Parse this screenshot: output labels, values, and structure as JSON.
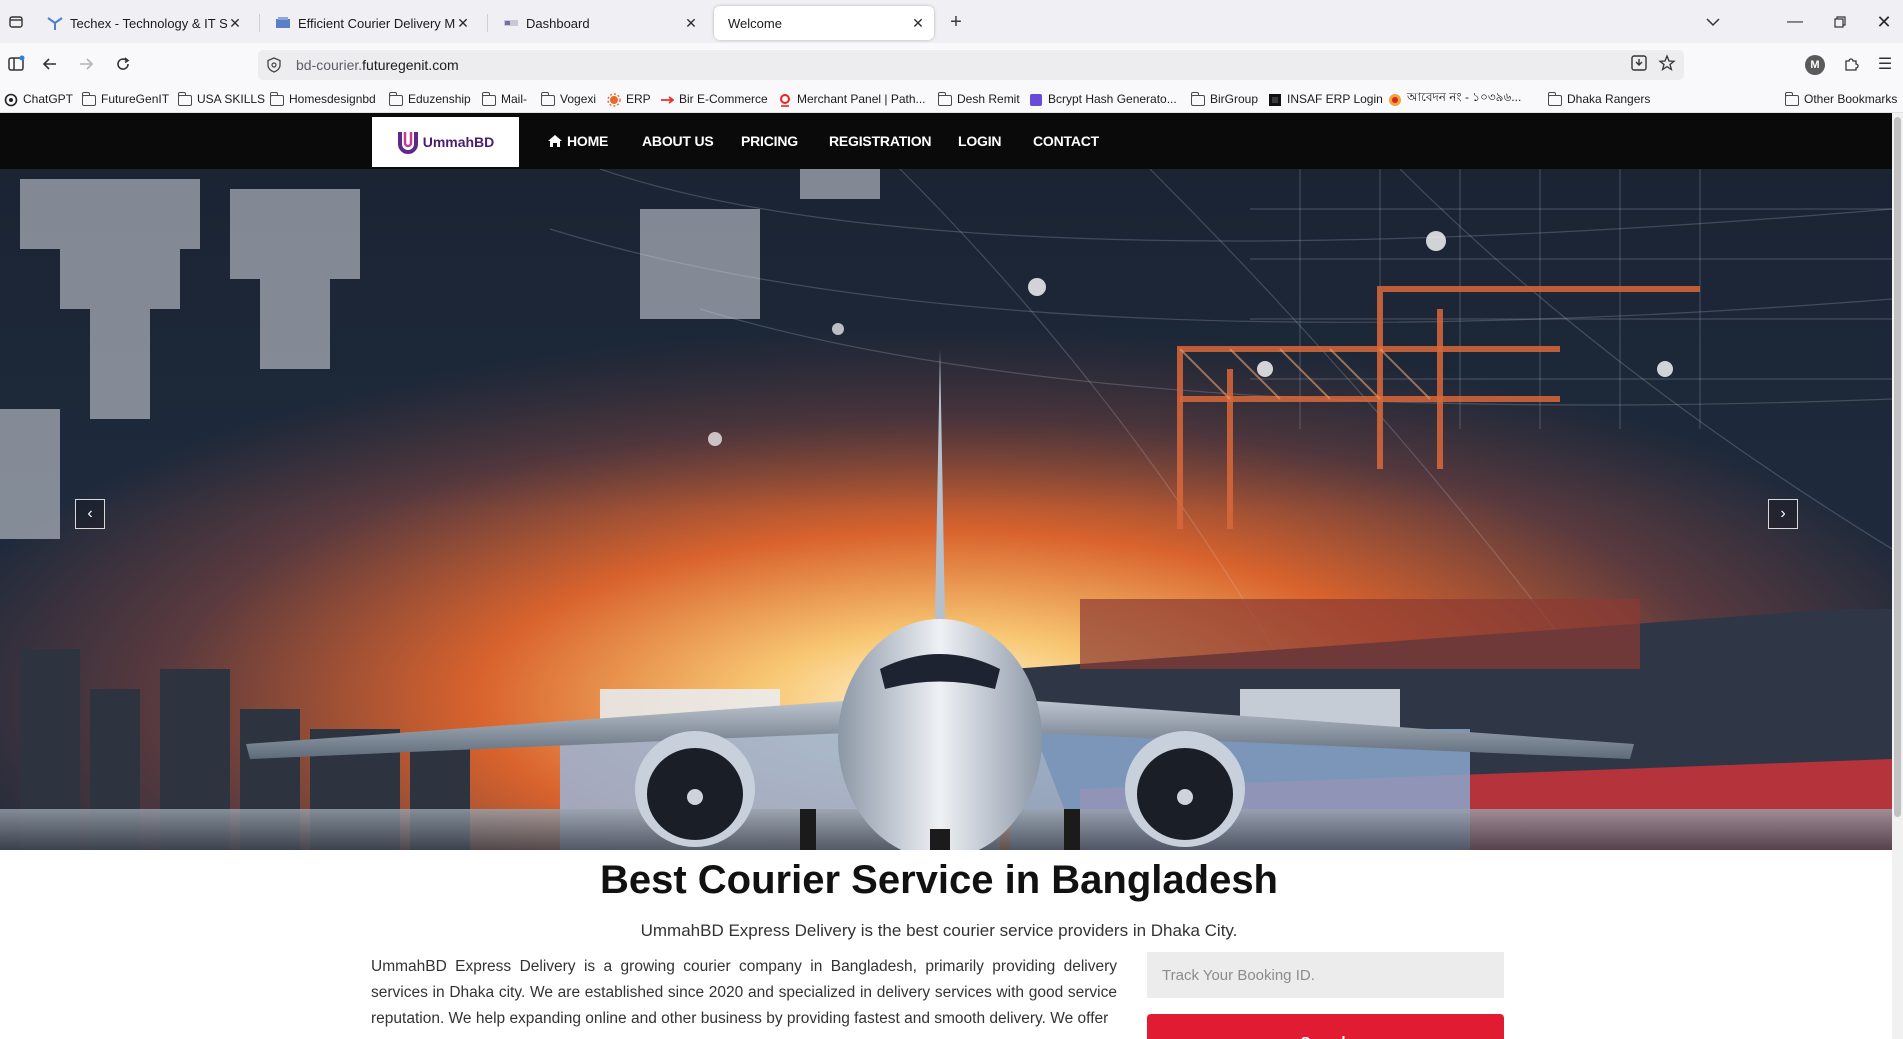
{
  "browser": {
    "tabs": [
      {
        "title": "Techex - Technology & IT Servic",
        "active": false
      },
      {
        "title": "Efficient Courier Delivery Manag",
        "active": false
      },
      {
        "title": "Dashboard",
        "active": false
      },
      {
        "title": "Welcome",
        "active": true
      }
    ],
    "url": {
      "prefix": "bd-courier.",
      "host": "futuregenit.com"
    },
    "profile_initial": "M",
    "bookmarks": [
      {
        "label": "ChatGPT",
        "icon": "chatgpt-icon"
      },
      {
        "label": "FutureGenIT",
        "icon": "folder-icon"
      },
      {
        "label": "USA SKILLS",
        "icon": "folder-icon"
      },
      {
        "label": "Homesdesignbd",
        "icon": "folder-icon"
      },
      {
        "label": "Eduzenship",
        "icon": "folder-icon"
      },
      {
        "label": "Mail-",
        "icon": "folder-icon"
      },
      {
        "label": "Vogexi",
        "icon": "folder-icon"
      },
      {
        "label": "ERP",
        "icon": "erp-icon"
      },
      {
        "label": "Bir E-Commerce",
        "icon": "bir-icon"
      },
      {
        "label": "Merchant Panel | Path...",
        "icon": "pathao-icon"
      },
      {
        "label": "Desh Remit",
        "icon": "folder-icon"
      },
      {
        "label": "Bcrypt Hash Generato...",
        "icon": "bcrypt-icon"
      },
      {
        "label": "BirGroup",
        "icon": "folder-icon"
      },
      {
        "label": "INSAF ERP Login",
        "icon": "insaf-icon"
      },
      {
        "label": "আবেদন নং - ১০৩৯৬...",
        "icon": "bd-gov-icon"
      },
      {
        "label": "Dhaka Rangers",
        "icon": "folder-icon"
      }
    ],
    "other_bookmarks": "Other Bookmarks"
  },
  "site": {
    "logo_text": "UmmahBD",
    "menu": [
      "HOME",
      "ABOUT US",
      "PRICING",
      "REGISTRATION",
      "LOGIN",
      "CONTACT"
    ],
    "hero_prev": "‹",
    "hero_next": "›",
    "title": "Best Courier Service in Bangladesh",
    "subtitle": "UmmahBD Express Delivery is the best courier service providers in Dhaka City.",
    "about": "UmmahBD Express Delivery is a growing courier company in Bangladesh, primarily providing delivery services in Dhaka city. We are established since 2020 and specialized in delivery services with good service reputation. We help expanding online and other business by providing fastest and smooth delivery. We offer",
    "track_placeholder": "Track Your Booking ID.",
    "search_label": "Search"
  },
  "colors": {
    "accent_red": "#e11b32",
    "header_black": "#0a0a0a",
    "logo_purple": "#4a1e6e"
  }
}
